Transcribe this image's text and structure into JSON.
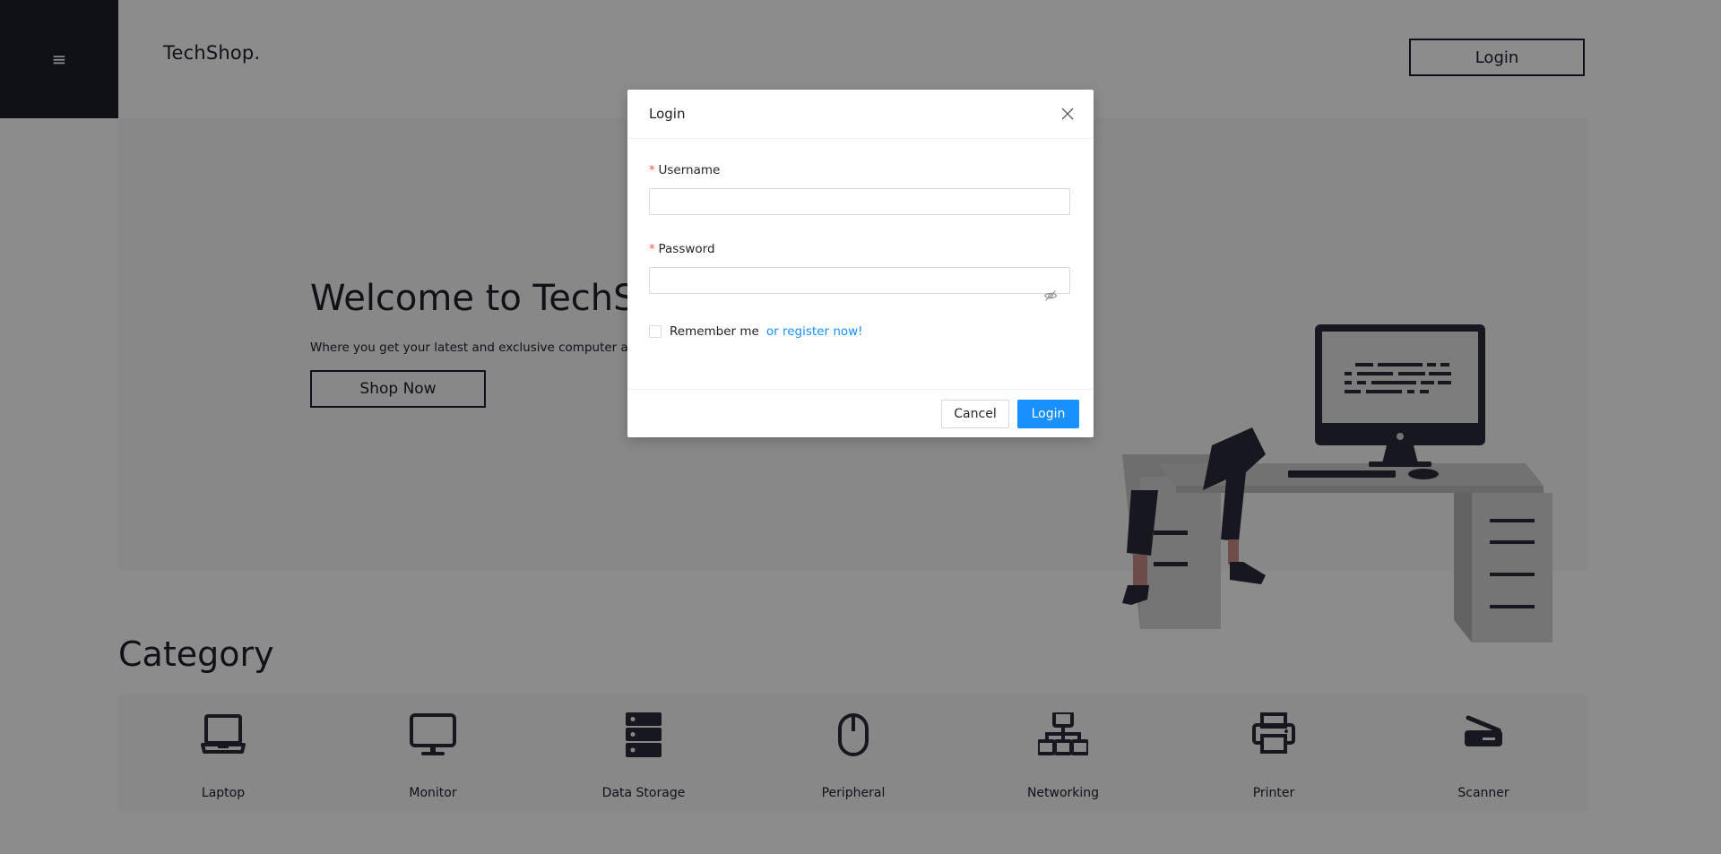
{
  "header": {
    "menu_icon": "hamburger-icon",
    "menu_glyph": "≡",
    "brand": "TechShop.",
    "login_label": "Login"
  },
  "hero": {
    "title": "Welcome to TechShop",
    "subtitle": "Where you get your latest and exclusive computer and",
    "cta_label": "Shop Now",
    "illustration": "person-sitting-at-desk-illustration"
  },
  "category": {
    "title": "Category",
    "items": [
      {
        "label": "Laptop",
        "icon": "laptop-icon"
      },
      {
        "label": "Monitor",
        "icon": "monitor-icon"
      },
      {
        "label": "Data Storage",
        "icon": "server-icon"
      },
      {
        "label": "Peripheral",
        "icon": "mouse-icon"
      },
      {
        "label": "Networking",
        "icon": "network-icon"
      },
      {
        "label": "Printer",
        "icon": "printer-icon"
      },
      {
        "label": "Scanner",
        "icon": "scanner-icon"
      }
    ]
  },
  "modal": {
    "title": "Login",
    "close_icon": "close-icon",
    "username_label": "Username",
    "username_value": "",
    "password_label": "Password",
    "password_value": "",
    "password_toggle_icon": "eye-invisible-icon",
    "remember_label": "Remember me",
    "remember_checked": false,
    "register_link": "or register now!",
    "cancel_label": "Cancel",
    "submit_label": "Login"
  },
  "colors": {
    "primary": "#1890ff",
    "dark": "#1c1c28",
    "required": "#ff4d4f"
  }
}
